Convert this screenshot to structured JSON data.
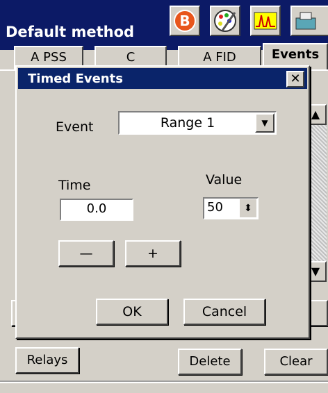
{
  "window": {
    "title": "Default method",
    "toolbar_icons": [
      "b-icon",
      "palette-icon",
      "peaks-icon",
      "printer-icon"
    ]
  },
  "tabs": [
    {
      "label": "A PSS"
    },
    {
      "label": "C"
    },
    {
      "label": "A FID"
    },
    {
      "label": "Events"
    }
  ],
  "background_buttons": {
    "relays": "Relays",
    "delete": "Delete",
    "clear": "Clear"
  },
  "dialog": {
    "title": "Timed Events",
    "close_glyph": "✕",
    "event_label": "Event",
    "event_value": "Range 1",
    "time_label": "Time",
    "time_value": "0.0",
    "value_label": "Value",
    "value_value": "50",
    "minus_label": "—",
    "plus_label": "+",
    "ok_label": "OK",
    "cancel_label": "Cancel"
  },
  "colors": {
    "titlebar": "#0c1a66",
    "dialog_titlebar": "#0a246a",
    "face": "#d4d0c8"
  }
}
